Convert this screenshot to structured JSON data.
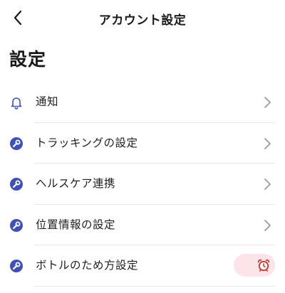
{
  "header": {
    "title": "アカウント設定",
    "back_icon": "chevron-left-icon"
  },
  "page_title": "設定",
  "colors": {
    "accent": "#3f51b5",
    "chevron": "#9a9a9a",
    "toggle_bg": "#fde4e8",
    "alarm": "#c0392b"
  },
  "settings": {
    "items": [
      {
        "label": "通知",
        "icon": "bell-icon",
        "trailing": "chevron"
      },
      {
        "label": "トラッキングの設定",
        "icon": "wrench-icon",
        "trailing": "chevron"
      },
      {
        "label": "ヘルスケア連携",
        "icon": "wrench-icon",
        "trailing": "chevron"
      },
      {
        "label": "位置情報の設定",
        "icon": "wrench-icon",
        "trailing": "chevron"
      },
      {
        "label": "ボトルのため方設定",
        "icon": "wrench-icon",
        "trailing": "toggle",
        "toggle_icon": "alarm-clock-icon"
      }
    ]
  }
}
